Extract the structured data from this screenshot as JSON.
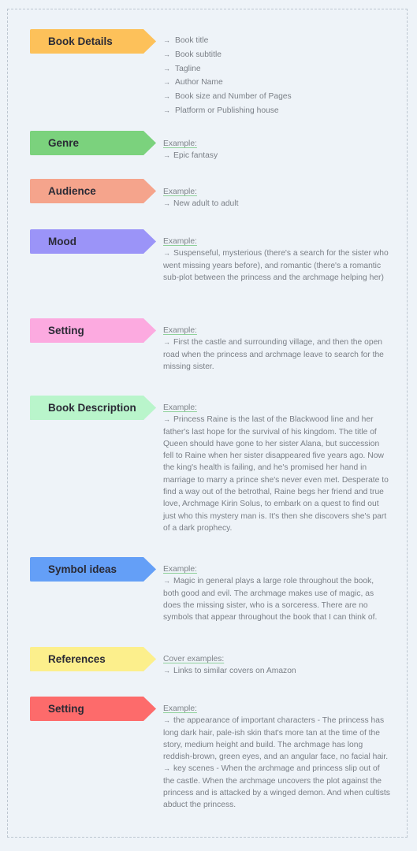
{
  "colors": {
    "book_details": "#fdc15a",
    "genre": "#7bd27d",
    "audience": "#f5a48c",
    "mood": "#9b94f8",
    "setting_pink": "#fcaae0",
    "book_description": "#b9f5cb",
    "symbol_ideas": "#649ff7",
    "references": "#fcef8c",
    "setting_red": "#fd6b6b",
    "example_underline": "#8fd19a"
  },
  "sections": [
    {
      "label": "Book Details",
      "items": [
        "Book title",
        "Book subtitle",
        "Tagline",
        "Author Name",
        "Book size and Number of Pages",
        "Platform or Publishing house"
      ]
    },
    {
      "label": "Genre",
      "heading": "Example:",
      "paragraphs": [
        "Epic fantasy"
      ]
    },
    {
      "label": "Audience",
      "heading": "Example:",
      "paragraphs": [
        "New adult to adult"
      ]
    },
    {
      "label": "Mood",
      "heading": "Example:",
      "paragraphs": [
        "Suspenseful, mysterious (there's a search for the sister who went missing years before), and romantic (there's a romantic sub-plot between the princess and the archmage helping her)"
      ]
    },
    {
      "label": "Setting",
      "heading": "Example:",
      "paragraphs": [
        "First the castle and surrounding village, and then the open road when the princess and archmage leave to search for the missing sister."
      ]
    },
    {
      "label": "Book Description",
      "heading": "Example:",
      "paragraphs": [
        "Princess Raine is the last of the Blackwood line and her father's last hope for the survival of his kingdom. The title of Queen should have gone to her sister Alana, but succession fell to Raine when her sister disappeared five years ago. Now the king's health is failing, and he's promised her hand in marriage to marry a prince she's never even met. Desperate to find a way out of the betrothal, Raine begs her friend and true love, Archmage Kirin Solus, to embark on a quest to find out just who this mystery man is. It's then she discovers she's part of a dark prophecy."
      ]
    },
    {
      "label": "Symbol ideas",
      "heading": "Example:",
      "paragraphs": [
        "Magic in general plays a large role throughout the book, both good and evil. The archmage makes use of magic, as does the missing sister, who is a sorceress. There are no symbols that appear throughout the book that I can think of."
      ]
    },
    {
      "label": "References",
      "heading": "Cover examples:",
      "paragraphs": [
        "Links to similar covers on Amazon"
      ]
    },
    {
      "label": "Setting",
      "heading": "Example:",
      "paragraphs": [
        "the appearance of important characters - The princess has long dark hair, pale-ish skin that's more tan at the time of the story, medium height and build. The archmage has long reddish-brown, green eyes, and an angular face, no facial hair.",
        "key scenes - When the archmage and princess slip out of the castle. When the archmage uncovers the plot against the princess and is attacked by a winged demon. And when cultists abduct the princess."
      ]
    }
  ],
  "icons": {
    "arrow": "→"
  }
}
